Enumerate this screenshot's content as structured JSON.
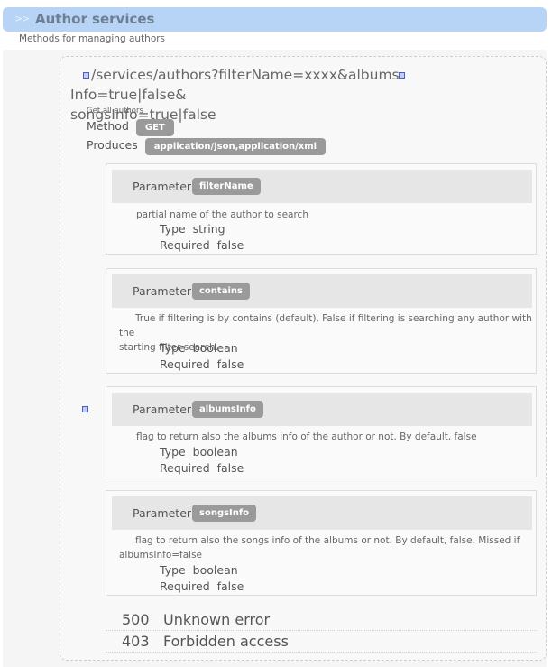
{
  "section": {
    "chevron": ">>",
    "title": "Author services",
    "description": "Methods for managing authors"
  },
  "endpoint": {
    "path_line1": "/services/authors?filterName=xxxx&albums",
    "path_line1_rest": "Info=true|false&",
    "path_line2": "songsInfo=true|false",
    "description": "Get all authors",
    "method_label": "Method",
    "method_value": "GET",
    "produces_label": "Produces",
    "produces_value": "application/json,application/xml"
  },
  "parameters": [
    {
      "label": "Parameter",
      "name": "filterName",
      "description": "partial name of the author to search",
      "type_label": "Type",
      "type": "string",
      "required_label": "Required",
      "required": "false"
    },
    {
      "label": "Parameter",
      "name": "contains",
      "description_line1": "True if filtering is by contains (default), False if filtering is searching any author with the",
      "description_line2": "starting filter search.",
      "type_label": "Type",
      "type": "boolean",
      "required_label": "Required",
      "required": "false"
    },
    {
      "label": "Parameter",
      "name": "albumsInfo",
      "description": "flag to return also the albums info of the author or not. By default, false",
      "type_label": "Type",
      "type": "boolean",
      "required_label": "Required",
      "required": "false"
    },
    {
      "label": "Parameter",
      "name": "songsInfo",
      "description_line1": "flag to return also the songs info of the albums or not. By default, false. Missed if",
      "description_line2": "albumsInfo=false",
      "type_label": "Type",
      "type": "boolean",
      "required_label": "Required",
      "required": "false"
    }
  ],
  "responses": [
    {
      "code": "500",
      "message": "Unknown error"
    },
    {
      "code": "403",
      "message": "Forbidden access"
    }
  ],
  "colors": {
    "header_bg": "#b7d3f5",
    "badge_bg": "#9a9a9a",
    "anchor_border": "#4a5cc8"
  }
}
